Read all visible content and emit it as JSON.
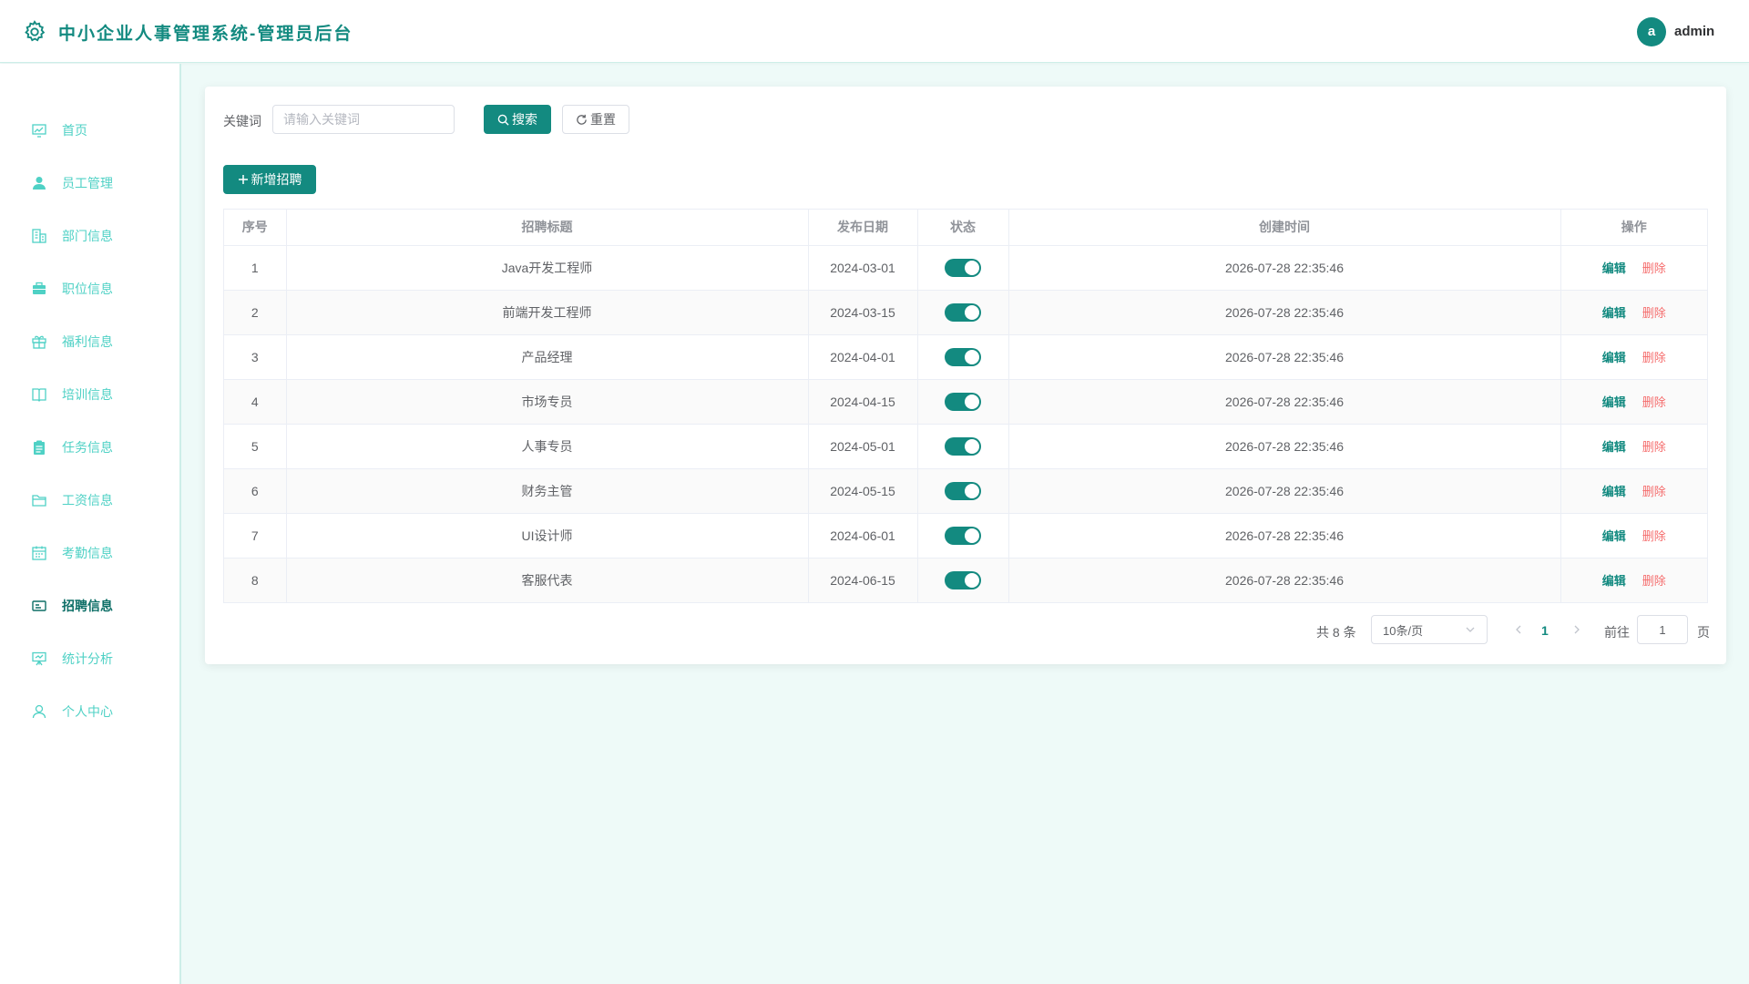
{
  "header": {
    "title": "中小企业人事管理系统-管理员后台",
    "avatar_letter": "a",
    "username": "admin"
  },
  "sidebar": {
    "items": [
      {
        "label": "首页",
        "icon": "chart-line-icon"
      },
      {
        "label": "员工管理",
        "icon": "user-icon"
      },
      {
        "label": "部门信息",
        "icon": "building-icon"
      },
      {
        "label": "职位信息",
        "icon": "briefcase-icon"
      },
      {
        "label": "福利信息",
        "icon": "gift-icon"
      },
      {
        "label": "培训信息",
        "icon": "book-icon"
      },
      {
        "label": "任务信息",
        "icon": "clipboard-icon"
      },
      {
        "label": "工资信息",
        "icon": "folder-icon"
      },
      {
        "label": "考勤信息",
        "icon": "calendar-icon"
      },
      {
        "label": "招聘信息",
        "icon": "id-card-icon",
        "active": true
      },
      {
        "label": "统计分析",
        "icon": "presentation-icon"
      },
      {
        "label": "个人中心",
        "icon": "user-outline-icon"
      }
    ]
  },
  "search": {
    "label": "关键词",
    "placeholder": "请输入关键词",
    "value": "",
    "search_button": "搜索",
    "reset_button": "重置"
  },
  "toolbar": {
    "add_button": "新增招聘"
  },
  "table": {
    "columns": [
      "序号",
      "招聘标题",
      "发布日期",
      "状态",
      "创建时间",
      "操作"
    ],
    "rows": [
      {
        "index": "1",
        "title": "Java开发工程师",
        "publish_date": "2024-03-01",
        "status_on": true,
        "created": "2026-07-28 22:35:46"
      },
      {
        "index": "2",
        "title": "前端开发工程师",
        "publish_date": "2024-03-15",
        "status_on": true,
        "created": "2026-07-28 22:35:46"
      },
      {
        "index": "3",
        "title": "产品经理",
        "publish_date": "2024-04-01",
        "status_on": true,
        "created": "2026-07-28 22:35:46"
      },
      {
        "index": "4",
        "title": "市场专员",
        "publish_date": "2024-04-15",
        "status_on": true,
        "created": "2026-07-28 22:35:46"
      },
      {
        "index": "5",
        "title": "人事专员",
        "publish_date": "2024-05-01",
        "status_on": true,
        "created": "2026-07-28 22:35:46"
      },
      {
        "index": "6",
        "title": "财务主管",
        "publish_date": "2024-05-15",
        "status_on": true,
        "created": "2026-07-28 22:35:46"
      },
      {
        "index": "7",
        "title": "UI设计师",
        "publish_date": "2024-06-01",
        "status_on": true,
        "created": "2026-07-28 22:35:46"
      },
      {
        "index": "8",
        "title": "客服代表",
        "publish_date": "2024-06-15",
        "status_on": true,
        "created": "2026-07-28 22:35:46"
      }
    ],
    "edit_label": "编辑",
    "delete_label": "删除"
  },
  "pagination": {
    "total_text": "共 8 条",
    "page_size": "10条/页",
    "current_page": "1",
    "goto_label": "前往",
    "goto_value": "1",
    "page_suffix": "页"
  },
  "colors": {
    "primary": "#138a80",
    "sidebar_text": "#4fd1c5",
    "danger": "#f56c6c",
    "background": "#eefaf8"
  }
}
